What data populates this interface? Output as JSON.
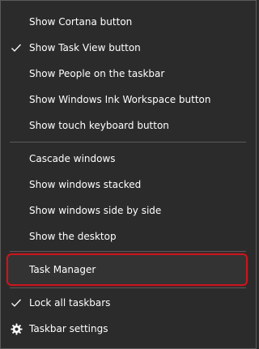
{
  "menu": {
    "items": [
      {
        "label": "Show Cortana button",
        "checked": false
      },
      {
        "label": "Show Task View button",
        "checked": true
      },
      {
        "label": "Show People on the taskbar",
        "checked": false
      },
      {
        "label": "Show Windows Ink Workspace button",
        "checked": false
      },
      {
        "label": "Show touch keyboard button",
        "checked": false
      },
      {
        "label": "Cascade windows",
        "checked": false
      },
      {
        "label": "Show windows stacked",
        "checked": false
      },
      {
        "label": "Show windows side by side",
        "checked": false
      },
      {
        "label": "Show the desktop",
        "checked": false
      },
      {
        "label": "Task Manager",
        "checked": false,
        "highlighted": true
      },
      {
        "label": "Lock all taskbars",
        "checked": true
      },
      {
        "label": "Taskbar settings",
        "icon": "gear-icon"
      }
    ]
  },
  "colors": {
    "background": "#2b2b2b",
    "text": "#ffffff",
    "separator": "#5b5b5b",
    "highlight_border": "#c8161d"
  }
}
